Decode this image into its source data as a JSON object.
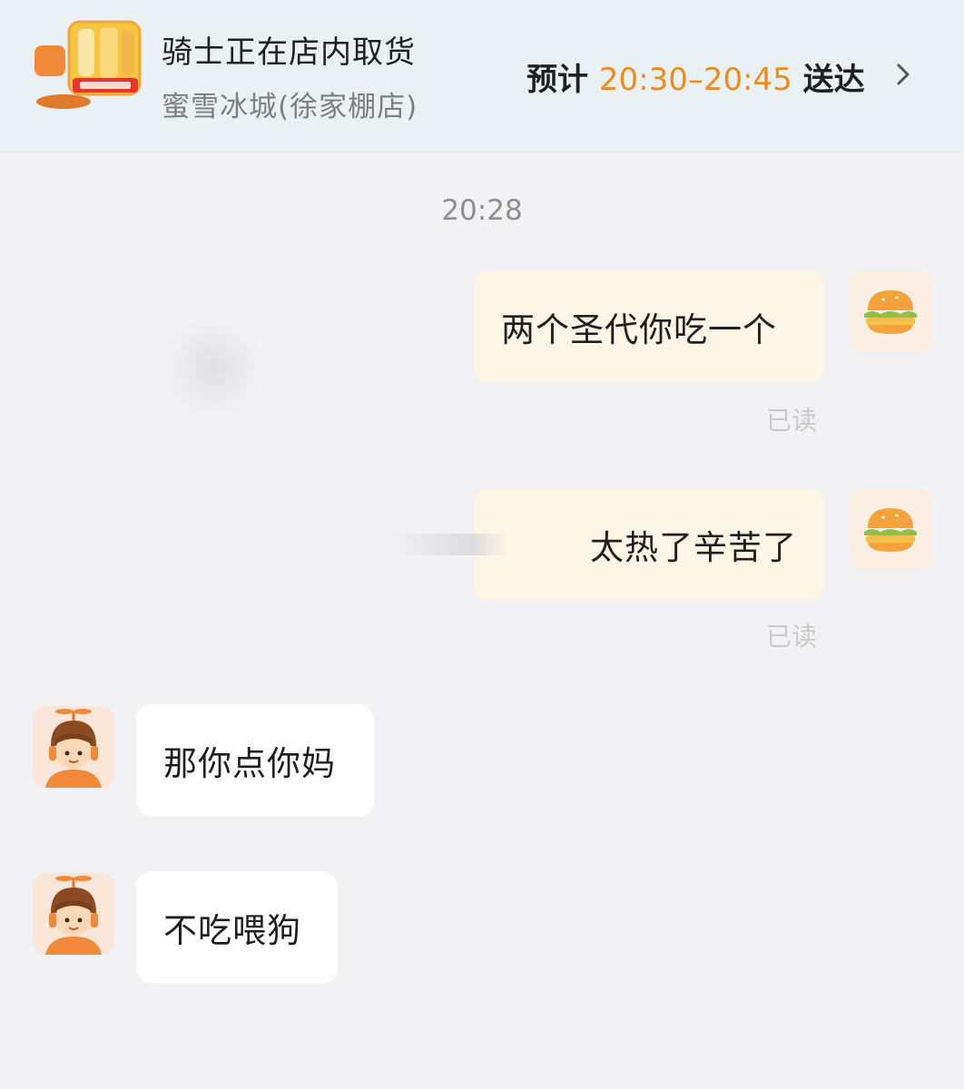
{
  "header": {
    "title": "骑士正在店内取货",
    "store_name": "蜜雪冰城(徐家棚店)",
    "eta_prefix": "预计",
    "eta_time": "20:30–20:45",
    "eta_suffix": "送达",
    "logo_icon": "mixue-shop-logo-icon",
    "chevron_icon": "chevron-right-icon",
    "accent_color": "#f08a1c"
  },
  "chat": {
    "timestamp": "20:28",
    "messages": [
      {
        "sender": "user",
        "text": "两个圣代你吃一个",
        "status": "已读",
        "avatar_icon": "burger-avatar-icon"
      },
      {
        "sender": "user",
        "text": "太热了辛苦了",
        "status": "已读",
        "avatar_icon": "burger-avatar-icon"
      },
      {
        "sender": "rider",
        "text": "那你点你妈",
        "avatar_icon": "rider-avatar-icon"
      },
      {
        "sender": "rider",
        "text": "不吃喂狗",
        "avatar_icon": "rider-avatar-icon"
      }
    ]
  }
}
